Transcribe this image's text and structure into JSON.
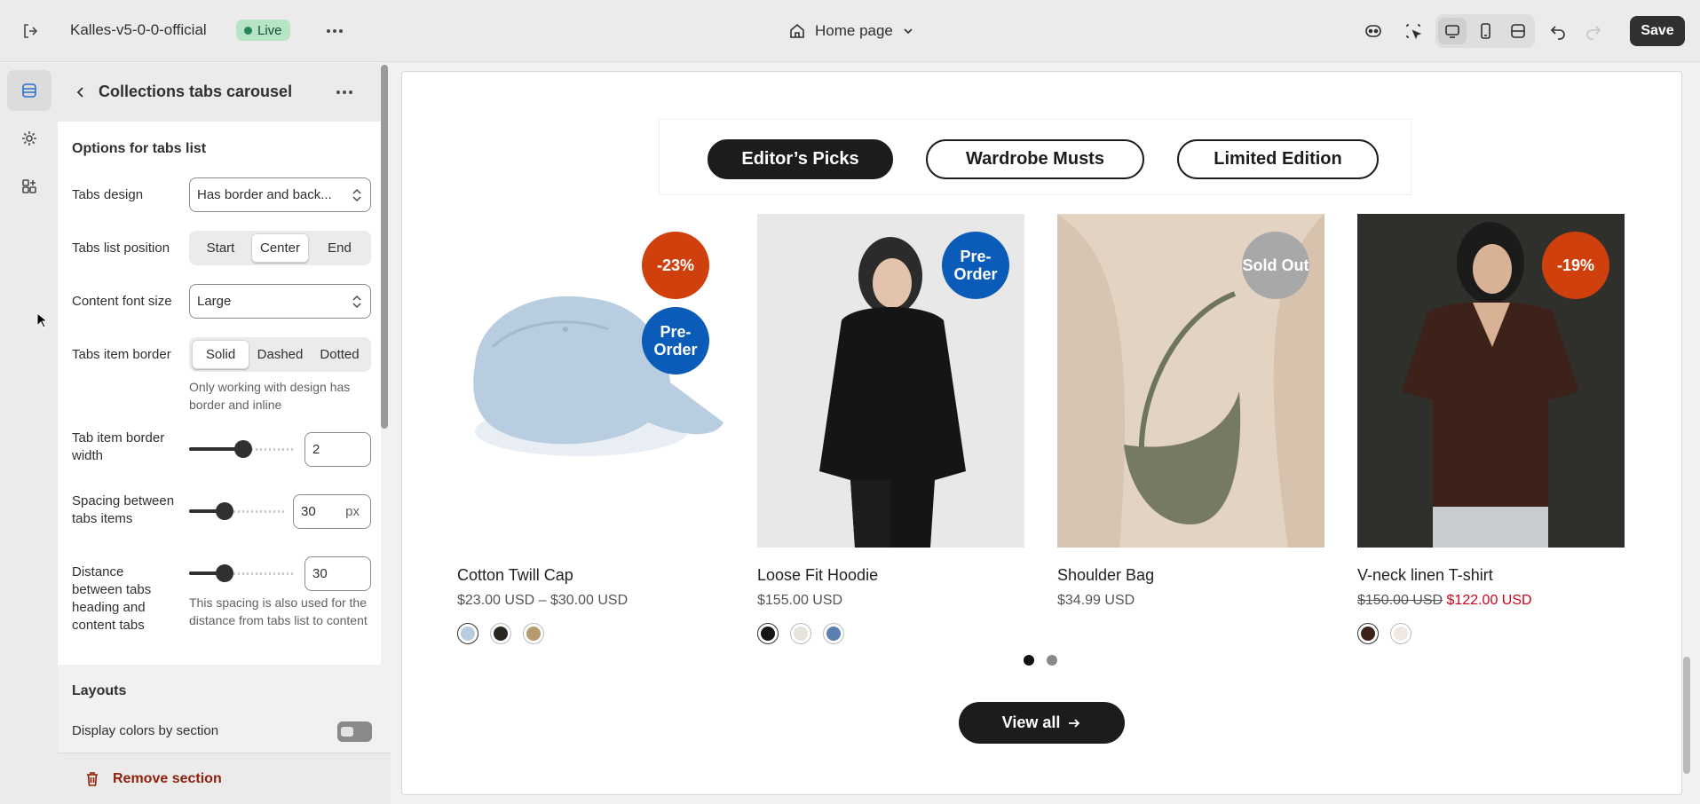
{
  "topbar": {
    "store_name": "Kalles-v5-0-0-official",
    "live_label": "Live",
    "page_label": "Home page",
    "save_label": "Save"
  },
  "panel": {
    "title": "Collections tabs carousel",
    "section_title": "Options for tabs list",
    "tabs_design": {
      "label": "Tabs design",
      "value": "Has border and back..."
    },
    "tabs_position": {
      "label": "Tabs list position",
      "options": [
        "Start",
        "Center",
        "End"
      ],
      "selected": "Center"
    },
    "content_font_size": {
      "label": "Content font size",
      "value": "Large"
    },
    "tabs_item_border": {
      "label": "Tabs item border",
      "options": [
        "Solid",
        "Dashed",
        "Dotted"
      ],
      "selected": "Solid",
      "help": "Only working with design has border and inline"
    },
    "tab_border_width": {
      "label": "Tab item border width",
      "value": "2"
    },
    "spacing_tabs": {
      "label": "Spacing between tabs items",
      "value": "30",
      "unit": "px"
    },
    "distance_heading": {
      "label": "Distance between tabs heading and content tabs",
      "value": "30",
      "help": "This spacing is also used for the distance from tabs list to content"
    },
    "layouts_title": "Layouts",
    "display_colors_label": "Display colors by section",
    "display_colors_on": false,
    "remove_label": "Remove section"
  },
  "preview": {
    "tabs": [
      {
        "label": "Editor’s Picks",
        "active": true
      },
      {
        "label": "Wardrobe Musts",
        "active": false
      },
      {
        "label": "Limited Edition",
        "active": false
      }
    ],
    "products": [
      {
        "name": "Cotton Twill Cap",
        "price": "$23.00 USD – $30.00 USD",
        "old_price": "",
        "sale_price": "",
        "badges": [
          "-23%",
          "Pre-Order"
        ]
      },
      {
        "name": "Loose Fit Hoodie",
        "price": "$155.00 USD",
        "old_price": "",
        "sale_price": "",
        "badges": [
          "Pre-Order"
        ]
      },
      {
        "name": "Shoulder Bag",
        "price": "$34.99 USD",
        "old_price": "",
        "sale_price": "",
        "badges": [
          "Sold Out"
        ]
      },
      {
        "name": "V-neck linen T-shirt",
        "price": "",
        "old_price": "$150.00 USD",
        "sale_price": "$122.00 USD",
        "badges": [
          "-19%"
        ]
      }
    ],
    "view_all_label": "View all",
    "carousel_page": 1,
    "carousel_pages": 2
  },
  "colors": {
    "sale_badge": "#d0400c",
    "preorder_badge": "#0b5bb8",
    "soldout_badge": "#a8a8a8",
    "sale_price": "#d0021b",
    "live_badge_bg": "#b7e4c4"
  }
}
